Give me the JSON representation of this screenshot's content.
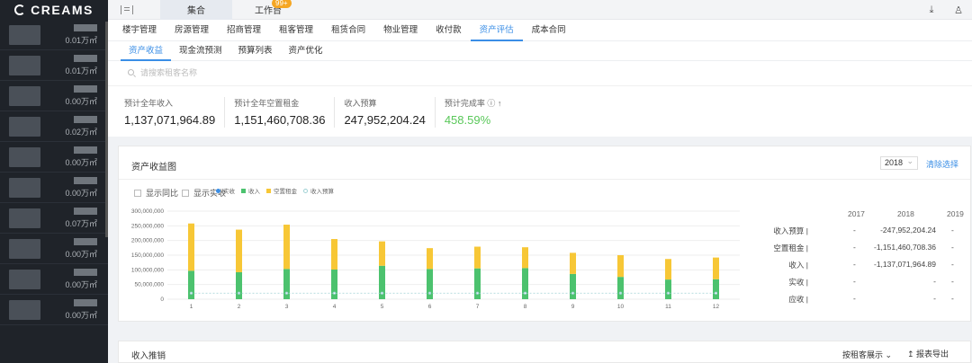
{
  "logo": "CREAMS",
  "sidebar": {
    "areas": [
      "0.01万㎡",
      "0.01万㎡",
      "0.00万㎡",
      "0.02万㎡",
      "0.00万㎡",
      "0.00万㎡",
      "0.07万㎡",
      "0.00万㎡",
      "0.00万㎡",
      "0.00万㎡"
    ]
  },
  "topbar": {
    "tabs": [
      "集合",
      "工作台"
    ],
    "badge": "99+"
  },
  "nav1": [
    "楼宇管理",
    "房源管理",
    "招商管理",
    "租客管理",
    "租赁合同",
    "物业管理",
    "收付款",
    "资产评估",
    "成本合同"
  ],
  "nav2": [
    "资产收益",
    "现金流预测",
    "预算列表",
    "资产优化"
  ],
  "search": {
    "placeholder": "请搜索租客名称"
  },
  "stats": [
    {
      "label": "预计全年收入",
      "value": "1,137,071,964.89"
    },
    {
      "label": "预计全年空置租金",
      "value": "1,151,460,708.36"
    },
    {
      "label": "收入预算",
      "value": "247,952,204.24"
    },
    {
      "label": "预计完成率 ⓘ ↑",
      "value": "458.59%"
    }
  ],
  "panel": {
    "title": "资产收益图",
    "year_select": "2018",
    "clear_label": "清除选择",
    "show_yoy": "显示同比",
    "show_actual": "显示实收",
    "legend": [
      "实收",
      "收入",
      "空置租金",
      "收入预算"
    ]
  },
  "chart_data": {
    "type": "bar",
    "categories": [
      "1",
      "2",
      "3",
      "4",
      "5",
      "6",
      "7",
      "8",
      "9",
      "10",
      "11",
      "12"
    ],
    "series": [
      {
        "name": "收入",
        "values": [
          97000000,
          92000000,
          103000000,
          101000000,
          114000000,
          103000000,
          105000000,
          106000000,
          86000000,
          76000000,
          67000000,
          68000000
        ]
      },
      {
        "name": "空置租金",
        "values": [
          161000000,
          145000000,
          151000000,
          104000000,
          83000000,
          71000000,
          74000000,
          71000000,
          72000000,
          74000000,
          70000000,
          74000000
        ]
      },
      {
        "name": "收入预算",
        "values": [
          20600000,
          20600000,
          20600000,
          20600000,
          20600000,
          20600000,
          20600000,
          20600000,
          20600000,
          20600000,
          20600000,
          20600000
        ]
      }
    ],
    "yticks": [
      "300,000,000",
      "250,000,000",
      "200,000,000",
      "150,000,000",
      "100,000,000",
      "50,000,000",
      "0"
    ],
    "ylim": [
      0,
      300000000
    ],
    "colors": {
      "收入": "#4cc26e",
      "空置租金": "#f7c736",
      "收入预算": "#9fd1d4",
      "实收": "#3a8ee6"
    }
  },
  "summary_table": {
    "years": [
      "2017",
      "2018",
      "2019"
    ],
    "rows": [
      {
        "label": "收入预算 |",
        "values": [
          "-",
          "-247,952,204.24",
          "-"
        ]
      },
      {
        "label": "空置租金 |",
        "values": [
          "-",
          "-1,151,460,708.36",
          "-"
        ]
      },
      {
        "label": "收入 |",
        "values": [
          "-",
          "-1,137,071,964.89",
          "-"
        ]
      },
      {
        "label": "实收 |",
        "values": [
          "-",
          "-",
          "-"
        ]
      },
      {
        "label": "应收 |",
        "values": [
          "-",
          "-",
          "-"
        ]
      }
    ]
  },
  "bottom": {
    "title": "收入推销",
    "show": "按租客展示 ⌄",
    "export": "↥ 报表导出"
  }
}
